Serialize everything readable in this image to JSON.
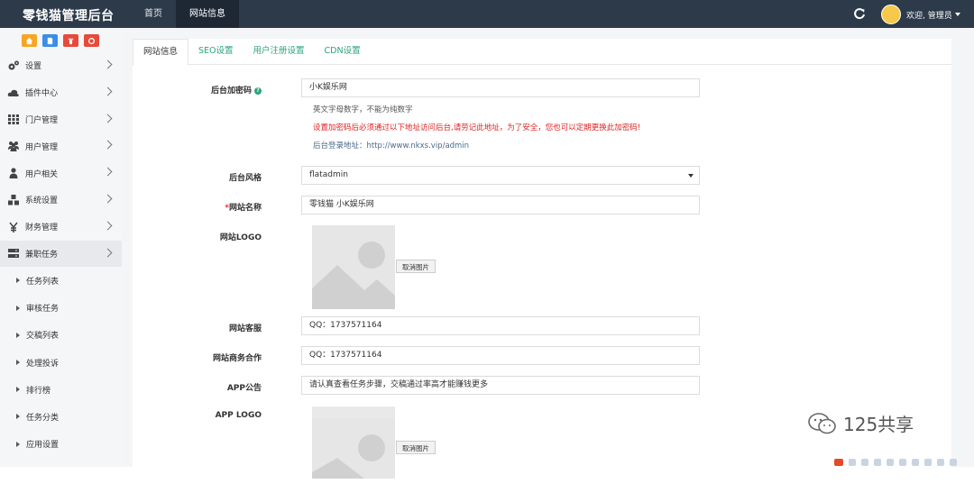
{
  "app": {
    "title": "零钱猫管理后台"
  },
  "top_nav": [
    {
      "label": "首页"
    },
    {
      "label": "网站信息"
    }
  ],
  "user": {
    "greeting": "欢迎, 管理员"
  },
  "sidebar": {
    "quick_buttons": [
      {
        "icon": "home-icon",
        "color": "#f5a623"
      },
      {
        "icon": "file-icon",
        "color": "#3a8ee6"
      },
      {
        "icon": "trash-icon",
        "color": "#e64a3b"
      },
      {
        "icon": "recycle-icon",
        "color": "#e64a3b"
      }
    ],
    "menu": [
      {
        "label": "设置",
        "icon": "gears-icon"
      },
      {
        "label": "插件中心",
        "icon": "cloud-icon"
      },
      {
        "label": "门户管理",
        "icon": "grid-icon"
      },
      {
        "label": "用户管理",
        "icon": "users-icon"
      },
      {
        "label": "用户相关",
        "icon": "user-icon"
      },
      {
        "label": "系统设置",
        "icon": "cubes-icon"
      },
      {
        "label": "财务管理",
        "icon": "yen-icon"
      },
      {
        "label": "兼职任务",
        "icon": "server-icon"
      }
    ],
    "submenu": [
      "任务列表",
      "审核任务",
      "交稿列表",
      "处理投诉",
      "排行榜",
      "任务分类",
      "应用设置"
    ]
  },
  "tabs": [
    "网站信息",
    "SEO设置",
    "用户注册设置",
    "CDN设置"
  ],
  "form": {
    "admin_key": {
      "label": "后台加密码",
      "value": "小K娱乐网",
      "help1": "英文字母数字，不能为纯数字",
      "help2": "设置加密码后必须通过以下地址访问后台,请劳记此地址，为了安全，您也可以定期更换此加密码!",
      "help3": "后台登录地址：http://www.nkxs.vip/admin"
    },
    "theme": {
      "label": "后台风格",
      "value": "flatadmin"
    },
    "site_name": {
      "required": "*",
      "label": "网站名称",
      "value": "零钱猫   小K娱乐网"
    },
    "site_logo": {
      "label": "网站LOGO",
      "cancel_label": "取消图片"
    },
    "support": {
      "label": "网站客服",
      "value": "QQ：1737571164"
    },
    "business": {
      "label": "网站商务合作",
      "value": "QQ：1737571164"
    },
    "app_notice": {
      "label": "APP公告",
      "value": "请认真查看任务步骤，交稿通过率高才能赚钱更多"
    },
    "app_logo": {
      "label": "APP LOGO",
      "cancel_label": "取消图片"
    }
  },
  "watermark": {
    "text": "125共享"
  },
  "colors": {
    "topbar": "#2c3a4a",
    "accent": "#2aa47f",
    "warning": "#e02020"
  }
}
